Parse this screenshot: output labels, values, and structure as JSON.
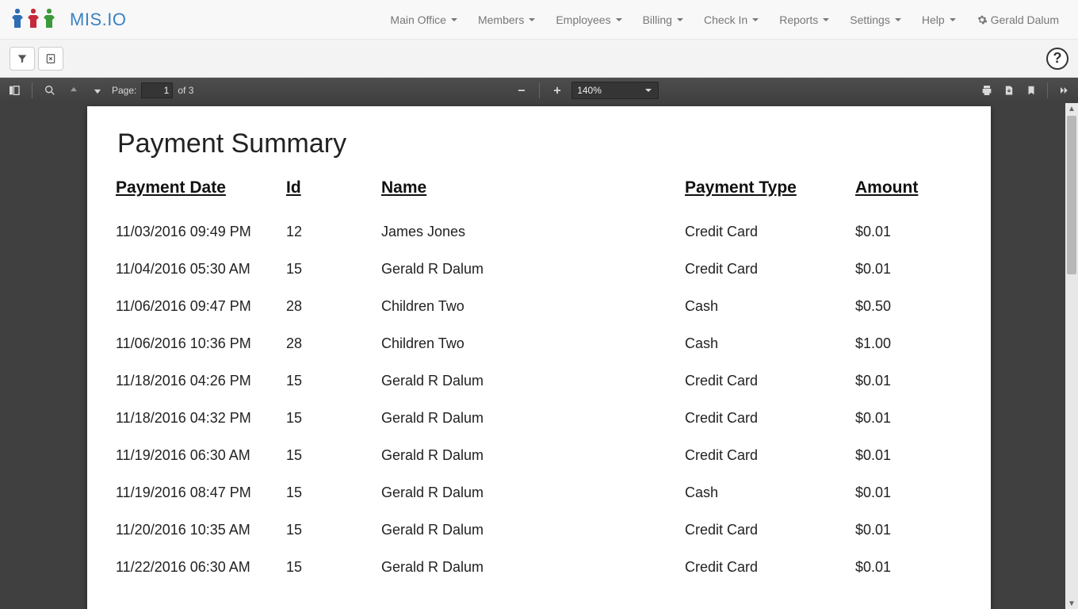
{
  "brand": {
    "text": "MIS.IO"
  },
  "nav": {
    "items": [
      {
        "label": "Main Office"
      },
      {
        "label": "Members"
      },
      {
        "label": "Employees"
      },
      {
        "label": "Billing"
      },
      {
        "label": "Check In"
      },
      {
        "label": "Reports"
      },
      {
        "label": "Settings"
      },
      {
        "label": "Help"
      }
    ],
    "user": "Gerald Dalum"
  },
  "help_icon": "?",
  "pdf": {
    "page_label": "Page:",
    "page_value": "1",
    "page_of": "of 3",
    "zoom": "140%"
  },
  "report": {
    "title": "Payment Summary",
    "headers": {
      "date": "Payment Date",
      "id": "Id",
      "name": "Name",
      "type": "Payment Type",
      "amount": "Amount"
    },
    "rows": [
      {
        "date": "11/03/2016 09:49 PM",
        "id": "12",
        "name": "James Jones",
        "type": "Credit Card",
        "amount": "$0.01"
      },
      {
        "date": "11/04/2016 05:30 AM",
        "id": "15",
        "name": "Gerald R Dalum",
        "type": "Credit Card",
        "amount": "$0.01"
      },
      {
        "date": "11/06/2016 09:47 PM",
        "id": "28",
        "name": "Children Two",
        "type": "Cash",
        "amount": "$0.50"
      },
      {
        "date": "11/06/2016 10:36 PM",
        "id": "28",
        "name": "Children Two",
        "type": "Cash",
        "amount": "$1.00"
      },
      {
        "date": "11/18/2016 04:26 PM",
        "id": "15",
        "name": "Gerald R Dalum",
        "type": "Credit Card",
        "amount": "$0.01"
      },
      {
        "date": "11/18/2016 04:32 PM",
        "id": "15",
        "name": "Gerald R Dalum",
        "type": "Credit Card",
        "amount": "$0.01"
      },
      {
        "date": "11/19/2016 06:30 AM",
        "id": "15",
        "name": "Gerald R Dalum",
        "type": "Credit Card",
        "amount": "$0.01"
      },
      {
        "date": "11/19/2016 08:47 PM",
        "id": "15",
        "name": "Gerald R Dalum",
        "type": "Cash",
        "amount": "$0.01"
      },
      {
        "date": "11/20/2016 10:35 AM",
        "id": "15",
        "name": "Gerald R Dalum",
        "type": "Credit Card",
        "amount": "$0.01"
      },
      {
        "date": "11/22/2016 06:30 AM",
        "id": "15",
        "name": "Gerald R Dalum",
        "type": "Credit Card",
        "amount": "$0.01"
      }
    ]
  }
}
